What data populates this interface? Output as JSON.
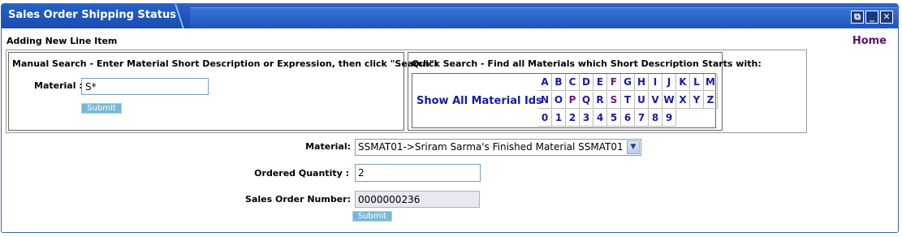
{
  "window": {
    "title": "Sales Order Shipping Status",
    "buttons": [
      "restore",
      "minimize",
      "close"
    ]
  },
  "header": {
    "subtitle": "Adding New Line Item",
    "home_link": "Home"
  },
  "manual_search": {
    "title": "Manual Search - Enter Material Short Description or Expression, then click \"Search\":",
    "material_label": "Material :",
    "material_value": "S*",
    "submit_label": "Submit"
  },
  "quick_search": {
    "title": "Quick Search - Find all Materials which Short Description Starts with:",
    "show_all_label": "Show All Material Ids",
    "rows": [
      [
        "A",
        "B",
        "C",
        "D",
        "E",
        "F",
        "G",
        "H",
        "I",
        "J",
        "K",
        "L",
        "M"
      ],
      [
        "N",
        "O",
        "P",
        "Q",
        "R",
        "S",
        "T",
        "U",
        "V",
        "W",
        "X",
        "Y",
        "Z"
      ],
      [
        "0",
        "1",
        "2",
        "3",
        "4",
        "5",
        "6",
        "7",
        "8",
        "9"
      ]
    ],
    "visited": [
      "F",
      "P",
      "S"
    ]
  },
  "form": {
    "material_label": "Material:",
    "material_selected": "SSMAT01->Sriram Sarma's Finished Material SSMAT01",
    "quantity_label": "Ordered Quantity :",
    "quantity_value": "2",
    "so_number_label": "Sales Order Number:",
    "so_number_value": "0000000236",
    "submit_label": "Submit"
  },
  "colors": {
    "title_bar": "#1f55bb",
    "link": "#1a1aa0",
    "visited_link": "#6a1a7a",
    "submit_button": "#78b8d8"
  }
}
